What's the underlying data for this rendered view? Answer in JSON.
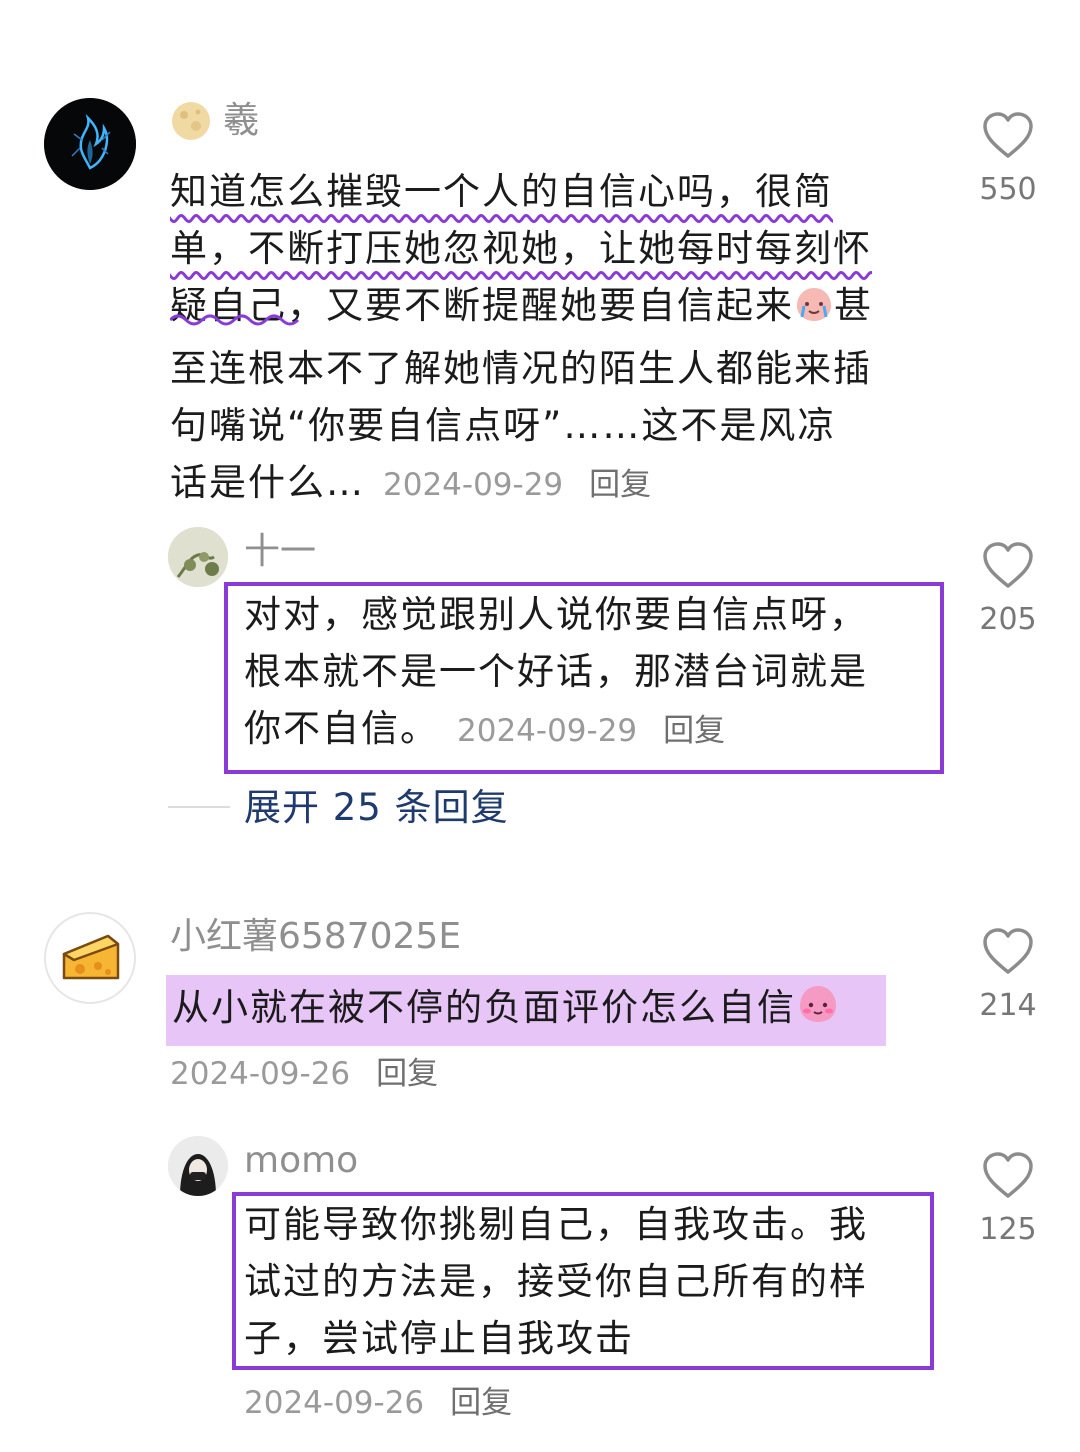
{
  "comments": [
    {
      "username": "羲",
      "text_lines": [
        "知道怎么摧毁一个人的自信心吗，很简",
        "单，不断打压她忽视她，让她每时每刻怀",
        "疑自己，又要不断提醒她要自信起来",
        "甚",
        "至连根本不了解她情况的陌生人都能来插",
        "句嘴说“你要自信点呀”……这不是风凉",
        "话是什么…"
      ],
      "date": "2024-09-29",
      "reply_label": "回复",
      "likes": "550",
      "replies": [
        {
          "username": "十一",
          "text_lines": [
            "对对，感觉跟别人说你要自信点呀，",
            "根本就不是一个好话，那潜台词就是",
            "你不自信。"
          ],
          "date": "2024-09-29",
          "reply_label": "回复",
          "likes": "205"
        }
      ],
      "expand_label": "展开 25 条回复"
    },
    {
      "username": "小红薯6587025E",
      "text": "从小就在被不停的负面评价怎么自信",
      "date": "2024-09-26",
      "reply_label": "回复",
      "likes": "214",
      "replies": [
        {
          "username": "momo",
          "text_lines": [
            "可能导致你挑剔自己，自我攻击。我",
            "试过的方法是，接受你自己所有的样",
            "子，尝试停止自我攻击"
          ],
          "date": "2024-09-26",
          "reply_label": "回复",
          "likes": "125"
        }
      ]
    }
  ],
  "colors": {
    "annotation_purple": "#8a3ad6",
    "highlight": "#e7c6f7",
    "link_blue": "#1f3a6e"
  },
  "icons": [
    "heart-outline-icon",
    "crying-emoji-icon",
    "shy-emoji-icon",
    "moon-emoji-icon"
  ]
}
